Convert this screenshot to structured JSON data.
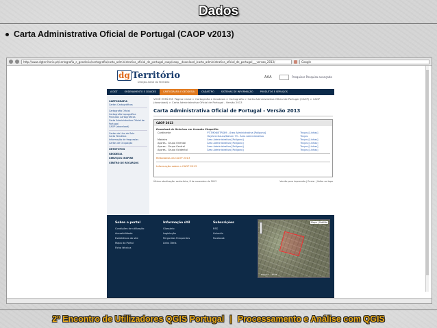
{
  "slide": {
    "title": "Dados",
    "bullet": "Carta Administrativa Oficial de Portugal (CAOP v2013)",
    "footer_left": "2º Encontro de Utilizadores QGIS Portugal",
    "footer_sep": "|",
    "footer_right": "Processamento e Análise com QGIS"
  },
  "browser": {
    "url": "http://www.dgterritorio.pt/cartografia_e_geodesia/cartografia/carta_administrativa_oficial_de_portugal_caop/caop__download_/carta_administrativa_oficial_de_portugal___versao_2013/",
    "search": "Google"
  },
  "site": {
    "logo_prefix": "dg",
    "logo": "Território",
    "logo_sub": "Direção-Geral do Território",
    "tools": [
      "AAA",
      "Pesquisar",
      "Pesquisa avançada"
    ],
    "nav": [
      "A DGT",
      "ORDENAMENTO E CIDADES",
      "CARTOGRAFIA E GEODESIA",
      "CADASTRO",
      "SISTEMAS DE INFORMAÇÃO",
      "PRODUTOS E SERVIÇOS"
    ],
    "leftnav": [
      {
        "cat": true,
        "label": "CARTOGRAFIA"
      },
      {
        "label": "Cartas Cartográficas"
      },
      {
        "label": "Cartografia Oficial"
      },
      {
        "label": "Cartografia topográfica"
      },
      {
        "label": "Produtos Cartográficos"
      },
      {
        "label": "Carta Administrativa Oficial de Portugal"
      },
      {
        "label": "CAOP (download)"
      },
      {
        "label": "Cartas de Uso do Solo"
      },
      {
        "label": "Carta Temática"
      },
      {
        "label": "Informação de freguesias"
      },
      {
        "label": "Cartas de Ocupação"
      },
      {
        "label": "ORTOFOTOS"
      },
      {
        "label": "GEODESIA"
      },
      {
        "label": "SERVIÇOS INSPIRE"
      },
      {
        "label": "CENTRO DE RECURSOS"
      }
    ],
    "crumbs": "VOCÊ ESTÁ EM: Página inicial > Cartografia e Geodesia > Cartografia > Carta Administrativa Oficial de Portugal (CAOP) > CAOP (download) > Carta Administrativa Oficial de Portugal - Versão 2013",
    "page_title": "Carta Administrativa Oficial de Portugal - Versão 2013",
    "panel_title": "CAOP 2013",
    "download_head": "Download de ficheiros em formato Shapefile:",
    "rows": [
      {
        "region": "Continente",
        "a": "PT-TM06/ETRS89 - Área Administrativa [Polígono]",
        "b": "Troços [Linhas]"
      },
      {
        "region": "",
        "a": "Hayford-Gauss/Datum 73 - Área Administrativa",
        "b": "Troços"
      },
      {
        "region": "Madeira",
        "a": "Área Administrativa [Polígono]",
        "b": "Troços [Linhas]"
      },
      {
        "region": "Açores - Grupo Oriental",
        "a": "Área Administrativa [Polígono]",
        "b": "Troços [Linhas]"
      },
      {
        "region": "Açores - Grupo Central",
        "a": "Área Administrativa [Polígono]",
        "b": "Troços [Linhas]"
      },
      {
        "region": "Açores - Grupo Ocidental",
        "a": "Área Administrativa [Polígono]",
        "b": "Troços [Linhas]"
      }
    ],
    "metadata": "Metadados da CAOP 2013",
    "info": "Informação sobre a CAOP 2013",
    "page_footer_left": "Última atualização: sexta-feira, 8 de novembro de 2013",
    "page_footer_right": "Versão para impressão | Enviar | Voltar ao topo",
    "footer_cols": [
      {
        "title": "Sobre o portal",
        "items": [
          "Condições de utilização",
          "Acessibilidade",
          "Estatísticas do site",
          "Mapa do Portal",
          "Ficha técnica"
        ]
      },
      {
        "title": "Informação útil",
        "items": [
          "Glossário",
          "Legislação",
          "Perguntas Frequentes",
          "Links Úteis"
        ]
      },
      {
        "title": "Subscrições",
        "items": [
          "RSS",
          "Linkedin",
          "Facebook"
        ]
      }
    ],
    "map_tab": "Mapa | Satélite",
    "map_caption": "Lisboa 1 - 2013"
  }
}
